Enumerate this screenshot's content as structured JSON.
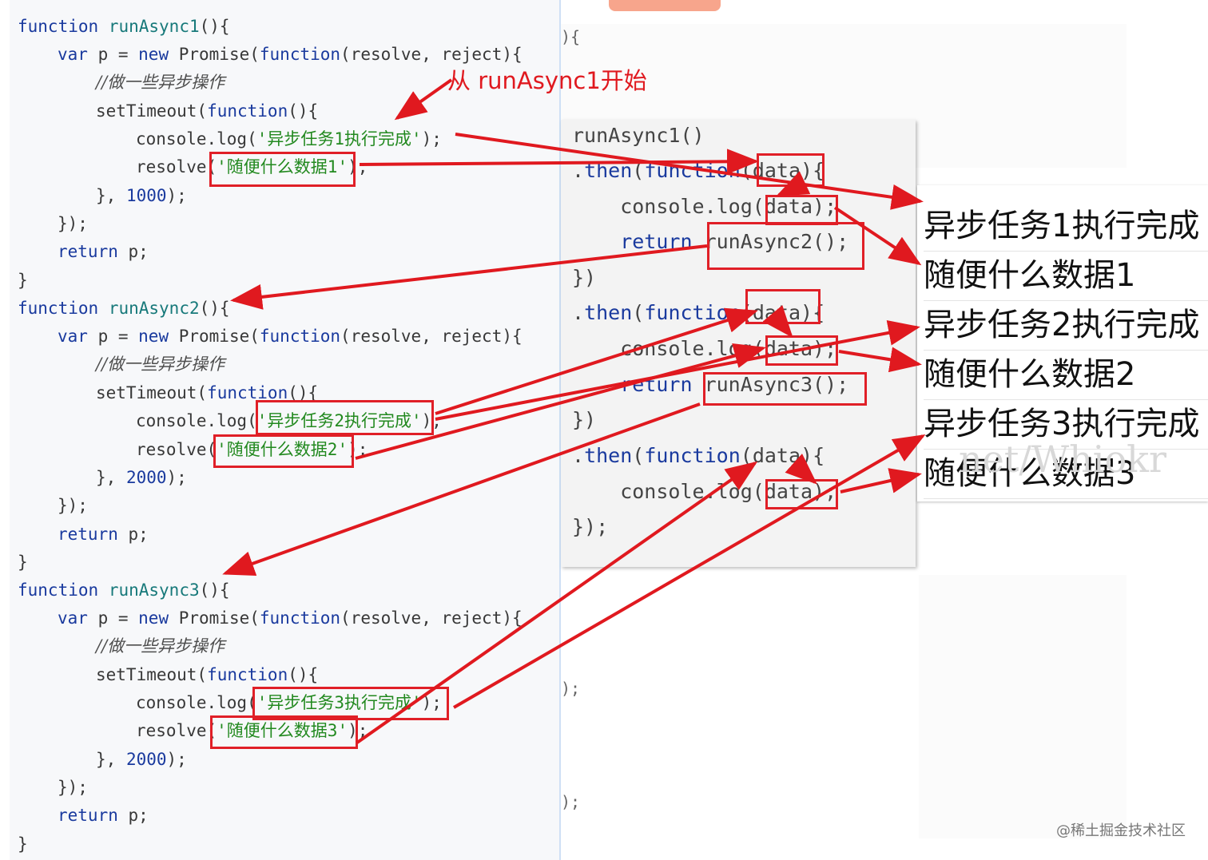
{
  "colors": {
    "arrow": "#e0191f",
    "keyword": "#1a3a9e",
    "function_name": "#17797a",
    "string": "#22891f"
  },
  "left_code": {
    "f1": {
      "decl_kw": "function",
      "decl_name": "runAsync1",
      "decl_tail": "(){",
      "var_line_kw": "var",
      "var_line_mid": " p = ",
      "new_kw": "new",
      "promise": " Promise(",
      "fn_kw": "function",
      "params": "(resolve, reject){",
      "comment": "//做一些异步操作",
      "settimeout_a": "setTimeout(",
      "settimeout_fn": "function",
      "settimeout_b": "(){",
      "log_a": "console.log(",
      "log_str": "'异步任务1执行完成'",
      "log_b": ");",
      "resolve_a": "resolve(",
      "resolve_str": "'随便什么数据1'",
      "resolve_b": ");",
      "timer_a": "}, ",
      "timer_num": "1000",
      "timer_b": ");",
      "close_promise": "});",
      "return_kw": "return",
      "return_tail": " p;",
      "close_fn": "}"
    },
    "f2": {
      "decl_kw": "function",
      "decl_name": "runAsync2",
      "decl_tail": "(){",
      "var_line_kw": "var",
      "var_line_mid": " p = ",
      "new_kw": "new",
      "promise": " Promise(",
      "fn_kw": "function",
      "params": "(resolve, reject){",
      "comment": "//做一些异步操作",
      "settimeout_a": "setTimeout(",
      "settimeout_fn": "function",
      "settimeout_b": "(){",
      "log_a": "console.log(",
      "log_str": "'异步任务2执行完成'",
      "log_b": ");",
      "resolve_a": "resolve(",
      "resolve_str": "'随便什么数据2'",
      "resolve_b": ");",
      "timer_a": "}, ",
      "timer_num": "2000",
      "timer_b": ");",
      "close_promise": "});",
      "return_kw": "return",
      "return_tail": " p;",
      "close_fn": "}"
    },
    "f3": {
      "decl_kw": "function",
      "decl_name": "runAsync3",
      "decl_tail": "(){",
      "var_line_kw": "var",
      "var_line_mid": " p = ",
      "new_kw": "new",
      "promise": " Promise(",
      "fn_kw": "function",
      "params": "(resolve, reject){",
      "comment": "//做一些异步操作",
      "settimeout_a": "setTimeout(",
      "settimeout_fn": "function",
      "settimeout_b": "(){",
      "log_a": "console.log(",
      "log_str": "'异步任务3执行完成'",
      "log_b": ");",
      "resolve_a": "resolve(",
      "resolve_str": "'随便什么数据3'",
      "resolve_b": ");",
      "timer_a": "}, ",
      "timer_num": "2000",
      "timer_b": ");",
      "close_promise": "});",
      "return_kw": "return",
      "return_tail": " p;",
      "close_fn": "}"
    }
  },
  "annotation": "从 runAsync1开始",
  "popup": {
    "line1": "runAsync1()",
    "then1_a": ".",
    "then1_kw": "then",
    "then1_b": "(",
    "then1_fn": "function",
    "then1_c": "(data){",
    "log1": "    console.log(data);",
    "ret1_kw": "    return",
    "ret1_tail": " runAsync2();",
    "close1": "})",
    "then2_a": ".",
    "then2_kw": "then",
    "then2_b": "(",
    "then2_fn": "function",
    "then2_c": "(data){",
    "log2": "    console.log(data);",
    "ret2_kw": "    return",
    "ret2_tail": " runAsync3();",
    "close2": "})",
    "then3_a": ".",
    "then3_kw": "then",
    "then3_b": "(",
    "then3_fn": "function",
    "then3_c": "(data){",
    "log3": "    console.log(data);",
    "close3": "});"
  },
  "output": [
    "异步任务1执行完成",
    "随便什么数据1",
    "异步任务2执行完成",
    "随便什么数据2",
    "异步任务3执行完成",
    "随便什么数据3"
  ],
  "edge_fragments": {
    "top": "){",
    "mid1": ");",
    "mid2": ");"
  },
  "watermark": "@稀土掘金技术社区"
}
